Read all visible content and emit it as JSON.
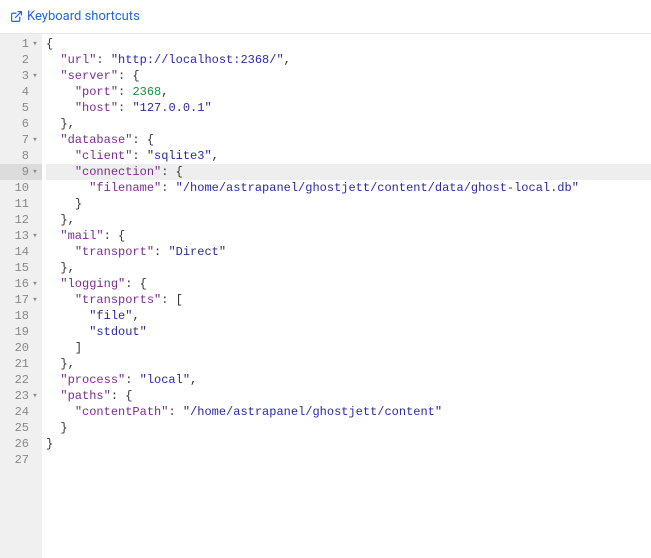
{
  "header": {
    "shortcuts_label": "Keyboard shortcuts"
  },
  "editor": {
    "highlighted_line": 9,
    "total_lines": 27,
    "lines": [
      {
        "n": 1,
        "fold": true,
        "indent": 0,
        "tokens": [
          {
            "t": "{",
            "c": "p"
          }
        ]
      },
      {
        "n": 2,
        "fold": false,
        "indent": 1,
        "tokens": [
          {
            "t": "\"url\"",
            "c": "k"
          },
          {
            "t": ": ",
            "c": "p"
          },
          {
            "t": "\"http://localhost:2368/\"",
            "c": "s"
          },
          {
            "t": ",",
            "c": "p"
          }
        ]
      },
      {
        "n": 3,
        "fold": true,
        "indent": 1,
        "tokens": [
          {
            "t": "\"server\"",
            "c": "k"
          },
          {
            "t": ": {",
            "c": "p"
          }
        ]
      },
      {
        "n": 4,
        "fold": false,
        "indent": 2,
        "tokens": [
          {
            "t": "\"port\"",
            "c": "k"
          },
          {
            "t": ": ",
            "c": "p"
          },
          {
            "t": "2368",
            "c": "n"
          },
          {
            "t": ",",
            "c": "p"
          }
        ]
      },
      {
        "n": 5,
        "fold": false,
        "indent": 2,
        "tokens": [
          {
            "t": "\"host\"",
            "c": "k"
          },
          {
            "t": ": ",
            "c": "p"
          },
          {
            "t": "\"127.0.0.1\"",
            "c": "s"
          }
        ]
      },
      {
        "n": 6,
        "fold": false,
        "indent": 1,
        "tokens": [
          {
            "t": "},",
            "c": "p"
          }
        ]
      },
      {
        "n": 7,
        "fold": true,
        "indent": 1,
        "tokens": [
          {
            "t": "\"database\"",
            "c": "k"
          },
          {
            "t": ": {",
            "c": "p"
          }
        ]
      },
      {
        "n": 8,
        "fold": false,
        "indent": 2,
        "tokens": [
          {
            "t": "\"client\"",
            "c": "k"
          },
          {
            "t": ": ",
            "c": "p"
          },
          {
            "t": "\"sqlite3\"",
            "c": "s"
          },
          {
            "t": ",",
            "c": "p"
          }
        ]
      },
      {
        "n": 9,
        "fold": true,
        "indent": 2,
        "tokens": [
          {
            "t": "\"connection\"",
            "c": "k"
          },
          {
            "t": ": {",
            "c": "p"
          }
        ]
      },
      {
        "n": 10,
        "fold": false,
        "indent": 3,
        "tokens": [
          {
            "t": "\"filename\"",
            "c": "k"
          },
          {
            "t": ": ",
            "c": "p"
          },
          {
            "t": "\"/home/astrapanel/ghostjett/content/data/ghost-local.db\"",
            "c": "s"
          }
        ]
      },
      {
        "n": 11,
        "fold": false,
        "indent": 2,
        "tokens": [
          {
            "t": "}",
            "c": "p"
          }
        ]
      },
      {
        "n": 12,
        "fold": false,
        "indent": 1,
        "tokens": [
          {
            "t": "},",
            "c": "p"
          }
        ]
      },
      {
        "n": 13,
        "fold": true,
        "indent": 1,
        "tokens": [
          {
            "t": "\"mail\"",
            "c": "k"
          },
          {
            "t": ": {",
            "c": "p"
          }
        ]
      },
      {
        "n": 14,
        "fold": false,
        "indent": 2,
        "tokens": [
          {
            "t": "\"transport\"",
            "c": "k"
          },
          {
            "t": ": ",
            "c": "p"
          },
          {
            "t": "\"Direct\"",
            "c": "s"
          }
        ]
      },
      {
        "n": 15,
        "fold": false,
        "indent": 1,
        "tokens": [
          {
            "t": "},",
            "c": "p"
          }
        ]
      },
      {
        "n": 16,
        "fold": true,
        "indent": 1,
        "tokens": [
          {
            "t": "\"logging\"",
            "c": "k"
          },
          {
            "t": ": {",
            "c": "p"
          }
        ]
      },
      {
        "n": 17,
        "fold": true,
        "indent": 2,
        "tokens": [
          {
            "t": "\"transports\"",
            "c": "k"
          },
          {
            "t": ": [",
            "c": "p"
          }
        ]
      },
      {
        "n": 18,
        "fold": false,
        "indent": 3,
        "tokens": [
          {
            "t": "\"file\"",
            "c": "s"
          },
          {
            "t": ",",
            "c": "p"
          }
        ]
      },
      {
        "n": 19,
        "fold": false,
        "indent": 3,
        "tokens": [
          {
            "t": "\"stdout\"",
            "c": "s"
          }
        ]
      },
      {
        "n": 20,
        "fold": false,
        "indent": 2,
        "tokens": [
          {
            "t": "]",
            "c": "p"
          }
        ]
      },
      {
        "n": 21,
        "fold": false,
        "indent": 1,
        "tokens": [
          {
            "t": "},",
            "c": "p"
          }
        ]
      },
      {
        "n": 22,
        "fold": false,
        "indent": 1,
        "tokens": [
          {
            "t": "\"process\"",
            "c": "k"
          },
          {
            "t": ": ",
            "c": "p"
          },
          {
            "t": "\"local\"",
            "c": "s"
          },
          {
            "t": ",",
            "c": "p"
          }
        ]
      },
      {
        "n": 23,
        "fold": true,
        "indent": 1,
        "tokens": [
          {
            "t": "\"paths\"",
            "c": "k"
          },
          {
            "t": ": {",
            "c": "p"
          }
        ]
      },
      {
        "n": 24,
        "fold": false,
        "indent": 2,
        "tokens": [
          {
            "t": "\"contentPath\"",
            "c": "k"
          },
          {
            "t": ": ",
            "c": "p"
          },
          {
            "t": "\"/home/astrapanel/ghostjett/content\"",
            "c": "s"
          }
        ]
      },
      {
        "n": 25,
        "fold": false,
        "indent": 1,
        "tokens": [
          {
            "t": "}",
            "c": "p"
          }
        ]
      },
      {
        "n": 26,
        "fold": false,
        "indent": 0,
        "tokens": [
          {
            "t": "}",
            "c": "p"
          }
        ]
      },
      {
        "n": 27,
        "fold": false,
        "indent": 0,
        "tokens": []
      }
    ]
  }
}
